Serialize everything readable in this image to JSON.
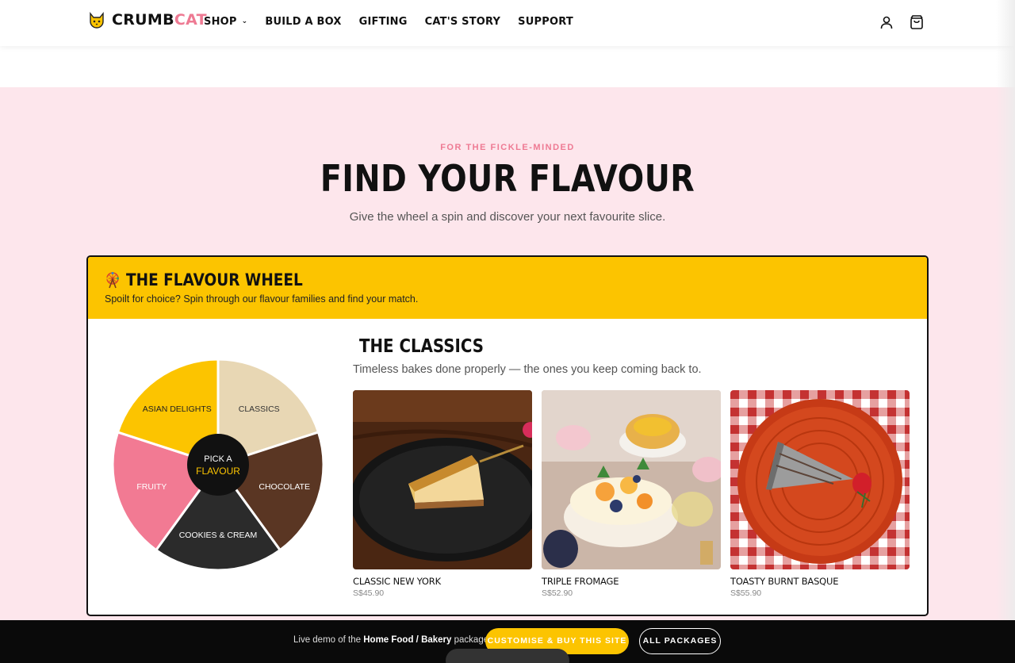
{
  "header": {
    "logo_part1": "CRUMB",
    "logo_part2": "CAT",
    "nav": [
      "SHOP",
      "BUILD A BOX",
      "GIFTING",
      "CAT'S STORY",
      "SUPPORT"
    ]
  },
  "hero": {
    "eyebrow": "FOR THE FICKLE-MINDED",
    "title": "FIND YOUR FLAVOUR",
    "subtitle": "Give the wheel a spin and discover your next favourite slice."
  },
  "card": {
    "title": "THE FLAVOUR WHEEL",
    "description": "Spoilt for choice? Spin through our flavour families and find your match."
  },
  "wheel": {
    "segments": [
      {
        "label": "CLASSICS",
        "color": "#e8d7b4",
        "text_color": "#333333"
      },
      {
        "label": "CHOCOLATE",
        "color": "#5a3623",
        "text_color": "#ffffff"
      },
      {
        "label": "COOKIES & CREAM",
        "color": "#2b2b2b",
        "text_color": "#ffffff"
      },
      {
        "label": "FRUITY",
        "color": "#f27a93",
        "text_color": "#ffffff"
      },
      {
        "label": "ASIAN DELIGHTS",
        "color": "#fcc400",
        "text_color": "#222222"
      }
    ],
    "center_line1": "PICK A",
    "center_line2": "FLAVOUR",
    "center_accent": "#fcc400"
  },
  "category": {
    "title": "THE CLASSICS",
    "description": "Timeless bakes done properly — the ones you keep coming back to.",
    "products": [
      {
        "name": "CLASSIC NEW YORK",
        "price": "S$45.90"
      },
      {
        "name": "TRIPLE FROMAGE",
        "price": "S$52.90"
      },
      {
        "name": "TOASTY BURNT BASQUE",
        "price": "S$55.90"
      }
    ]
  },
  "bottom_bar": {
    "text_prefix": "Live demo of the ",
    "text_bold": "Home Food / Bakery",
    "text_suffix": " package.",
    "buy_button": "CUSTOMISE & BUY THIS SITE →",
    "all_button": "ALL PACKAGES"
  },
  "colors": {
    "brand_pink": "#ee7a93",
    "brand_yellow": "#fcc400",
    "section_bg": "#fde6ec"
  }
}
